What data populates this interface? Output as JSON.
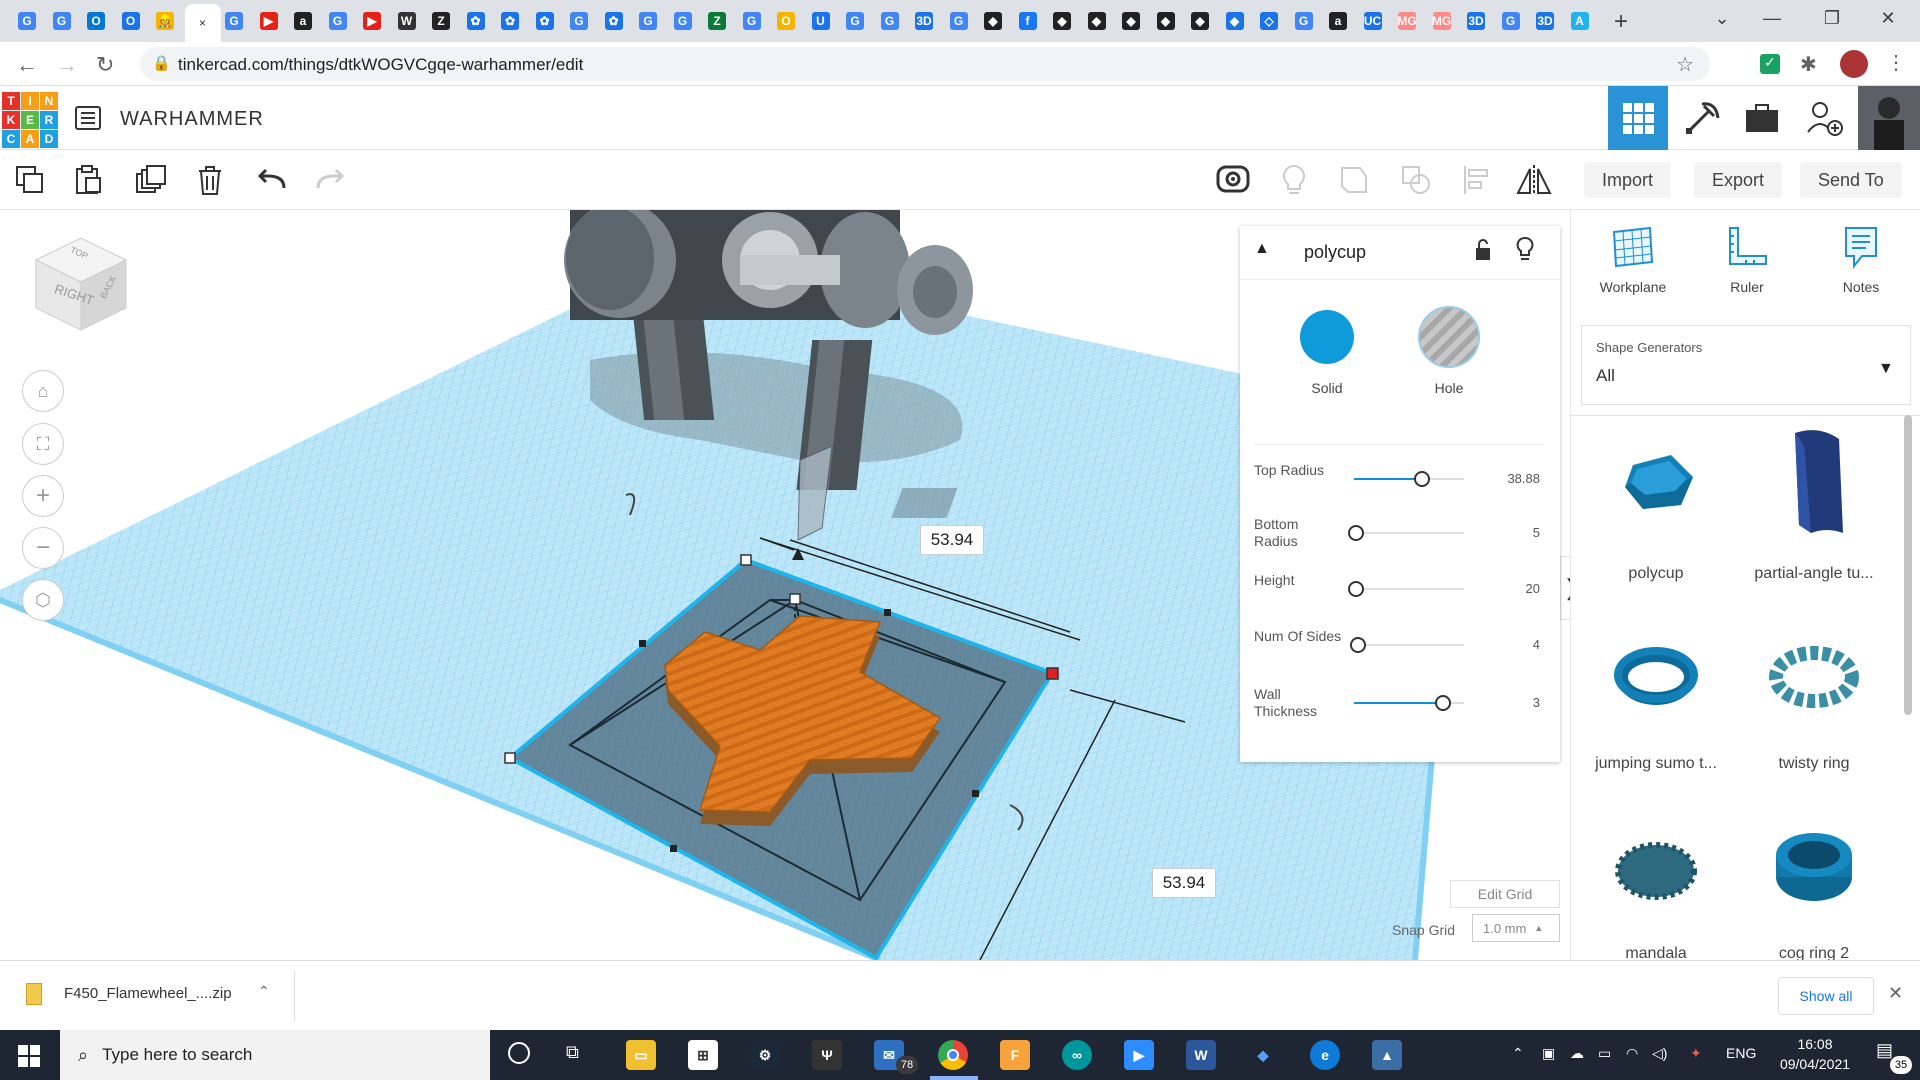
{
  "browser": {
    "url": "tinkercad.com/things/dtkWOGVCgqe-warhammer/edit",
    "new_tab_label": "+",
    "tab_glyphs": [
      "G",
      "G",
      "O",
      "O",
      "👷",
      "×",
      "G",
      "▶",
      "a",
      "G",
      "▶",
      "W",
      "Z",
      "✿",
      "✿",
      "✿",
      "G",
      "✿",
      "G",
      "G",
      "Z",
      "G",
      "O",
      "U",
      "G",
      "G",
      "3D",
      "G",
      "◆",
      "f",
      "◆",
      "◆",
      "◆",
      "◆",
      "◆",
      "◆",
      "◇",
      "G",
      "a",
      "UC",
      "MG",
      "MG",
      "3D",
      "G",
      "3D",
      "A"
    ]
  },
  "app": {
    "design_title": "WARHAMMER",
    "logo_letters": [
      "T",
      "I",
      "N",
      "K",
      "E",
      "R",
      "C",
      "A",
      "D"
    ]
  },
  "toolbar": {
    "import_label": "Import",
    "export_label": "Export",
    "send_to_label": "Send To"
  },
  "viewcube": {
    "face_label": "RIGHT",
    "side_label": "BACK",
    "top_label": "TOP"
  },
  "dimensions": {
    "width_value": "53.94",
    "depth_value": "53.94"
  },
  "inspector": {
    "shape_name": "polycup",
    "solid_label": "Solid",
    "hole_label": "Hole",
    "params": [
      {
        "label": "Top Radius",
        "value": "38.88",
        "fraction": 0.6
      },
      {
        "label": "Bottom Radius",
        "value": "5",
        "fraction": 0.0
      },
      {
        "label": "Height",
        "value": "20",
        "fraction": 0.0
      },
      {
        "label": "Num Of Sides",
        "value": "4",
        "fraction": 0.02
      },
      {
        "label": "Wall Thickness",
        "value": "3",
        "fraction": 0.79
      }
    ]
  },
  "grid_controls": {
    "edit_grid_label": "Edit Grid",
    "snap_grid_label": "Snap Grid",
    "snap_grid_value": "1.0 mm"
  },
  "right_panel": {
    "tools": [
      {
        "label": "Workplane",
        "icon": "workplane-icon"
      },
      {
        "label": "Ruler",
        "icon": "ruler-icon"
      },
      {
        "label": "Notes",
        "icon": "notes-icon"
      }
    ],
    "shape_generators_label": "Shape Generators",
    "shape_generators_value": "All",
    "shapes": [
      {
        "name": "polycup"
      },
      {
        "name": "partial-angle tu..."
      },
      {
        "name": "jumping sumo t..."
      },
      {
        "name": "twisty ring"
      },
      {
        "name": "mandala"
      },
      {
        "name": "cog ring 2"
      }
    ]
  },
  "downloads": {
    "file_name": "F450_Flamewheel_....zip",
    "show_all_label": "Show all"
  },
  "taskbar": {
    "search_placeholder": "Type here to search",
    "mail_badge": "78",
    "language": "ENG",
    "time": "16:08",
    "date": "09/04/2021",
    "notification_count": "35"
  },
  "colors": {
    "accent_blue": "#0f8fd6",
    "grid_blue": "#8fd3f2",
    "shape_orange": "#e07b22"
  }
}
